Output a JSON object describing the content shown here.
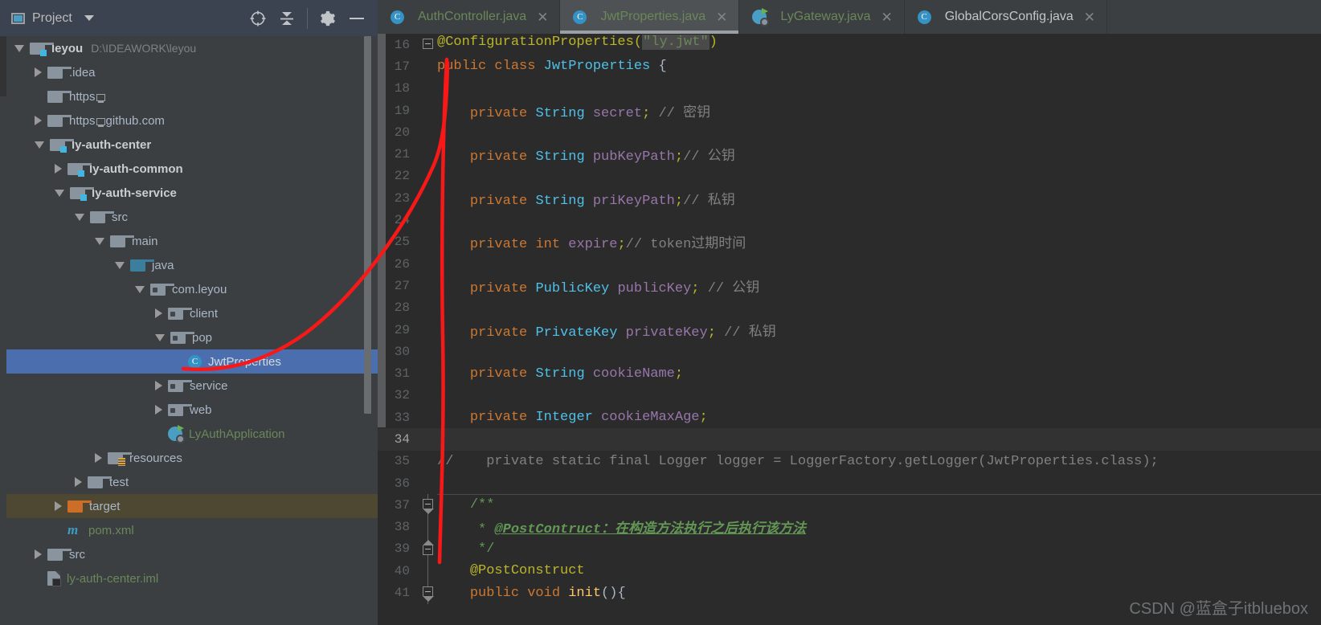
{
  "toolwindow": {
    "title": "Project",
    "title_icon": "project-view-icon",
    "dropdown_icon": "chevron-down-icon",
    "actions": [
      {
        "name": "locate-icon",
        "glyph": "scope-target"
      },
      {
        "name": "collapse-all-icon",
        "glyph": "collapse"
      },
      {
        "name": "settings-gear-icon",
        "glyph": "gear"
      },
      {
        "name": "minimize-icon",
        "glyph": "minus"
      }
    ]
  },
  "tree": [
    {
      "indent": 0,
      "arrow": "open",
      "icon": "module-folder-icon",
      "label": "leyou",
      "style": "bold",
      "hint": "D:\\IDEAWORK\\leyou"
    },
    {
      "indent": 1,
      "arrow": "closed",
      "icon": "folder-icon",
      "label": ".idea",
      "style": "plain",
      "hint": ""
    },
    {
      "indent": 1,
      "arrow": "none",
      "icon": "folder-icon",
      "label": "https",
      "style": "plain",
      "hint": "",
      "glyph_suffix": "monitor"
    },
    {
      "indent": 1,
      "arrow": "closed",
      "icon": "folder-icon",
      "label": "github.com",
      "style": "plain",
      "hint": "",
      "prefix": "https",
      "glyph_mid": "monitor"
    },
    {
      "indent": 1,
      "arrow": "open",
      "icon": "module-folder-icon",
      "label": "ly-auth-center",
      "style": "bold",
      "hint": ""
    },
    {
      "indent": 2,
      "arrow": "closed",
      "icon": "module-folder-icon",
      "label": "ly-auth-common",
      "style": "bold",
      "hint": ""
    },
    {
      "indent": 2,
      "arrow": "open",
      "icon": "module-folder-icon",
      "label": "ly-auth-service",
      "style": "bold",
      "hint": ""
    },
    {
      "indent": 3,
      "arrow": "open",
      "icon": "folder-icon",
      "label": "src",
      "style": "plain",
      "hint": ""
    },
    {
      "indent": 4,
      "arrow": "open",
      "icon": "folder-icon",
      "label": "main",
      "style": "plain",
      "hint": ""
    },
    {
      "indent": 5,
      "arrow": "open",
      "icon": "source-folder-icon",
      "label": "java",
      "style": "plain",
      "hint": ""
    },
    {
      "indent": 6,
      "arrow": "open",
      "icon": "package-icon",
      "label": "com.leyou",
      "style": "plain",
      "hint": ""
    },
    {
      "indent": 7,
      "arrow": "closed",
      "icon": "package-icon",
      "label": "client",
      "style": "plain",
      "hint": ""
    },
    {
      "indent": 7,
      "arrow": "open",
      "icon": "package-icon",
      "label": "pop",
      "style": "plain",
      "hint": ""
    },
    {
      "indent": 8,
      "arrow": "none",
      "icon": "java-class-icon",
      "label": "JwtProperties",
      "style": "white",
      "hint": "",
      "selected": true
    },
    {
      "indent": 7,
      "arrow": "closed",
      "icon": "package-icon",
      "label": "service",
      "style": "plain",
      "hint": ""
    },
    {
      "indent": 7,
      "arrow": "closed",
      "icon": "package-icon",
      "label": "web",
      "style": "plain",
      "hint": ""
    },
    {
      "indent": 7,
      "arrow": "none",
      "icon": "spring-boot-class-icon",
      "label": "LyAuthApplication",
      "style": "green",
      "hint": ""
    },
    {
      "indent": 4,
      "arrow": "closed",
      "icon": "resources-folder-icon",
      "label": "resources",
      "style": "plain",
      "hint": ""
    },
    {
      "indent": 3,
      "arrow": "closed",
      "icon": "folder-icon",
      "label": "test",
      "style": "plain",
      "hint": ""
    },
    {
      "indent": 2,
      "arrow": "closed",
      "icon": "target-folder-icon",
      "label": "target",
      "style": "plain",
      "hint": "",
      "highlighted": true
    },
    {
      "indent": 2,
      "arrow": "none",
      "icon": "maven-pom-icon",
      "label": "pom.xml",
      "style": "green",
      "hint": ""
    },
    {
      "indent": 1,
      "arrow": "closed",
      "icon": "folder-icon",
      "label": "src",
      "style": "plain",
      "hint": ""
    },
    {
      "indent": 1,
      "arrow": "none",
      "icon": "iml-file-icon",
      "label": "ly-auth-center.iml",
      "style": "green",
      "hint": ""
    }
  ],
  "tabs": [
    {
      "label": "AuthController.java",
      "icon": "java-class-icon",
      "active": false,
      "color": "green",
      "close_icon": "close-icon"
    },
    {
      "label": "JwtProperties.java",
      "icon": "java-class-icon",
      "active": true,
      "color": "green",
      "close_icon": "close-icon"
    },
    {
      "label": "LyGateway.java",
      "icon": "spring-boot-class-icon",
      "active": false,
      "color": "green",
      "close_icon": "close-icon"
    },
    {
      "label": "GlobalCorsConfig.java",
      "icon": "java-class-icon",
      "active": false,
      "color": "white",
      "close_icon": "close-icon"
    }
  ],
  "code": {
    "first_line": 16,
    "current_line": 34,
    "lines": [
      {
        "n": 16,
        "fold": "box",
        "clipped": true,
        "tokens": [
          {
            "t": "@ConfigurationProperties(",
            "c": "an"
          },
          {
            "t": "\"ly.jwt\"",
            "c": "s str-hl"
          },
          {
            "t": ")",
            "c": "an"
          }
        ]
      },
      {
        "n": 17,
        "fold": "",
        "tokens": [
          {
            "t": "public class ",
            "c": "k"
          },
          {
            "t": "JwtProperties",
            "c": "t"
          },
          {
            "t": " {",
            "c": "p"
          }
        ]
      },
      {
        "n": 18,
        "fold": "",
        "tokens": []
      },
      {
        "n": 19,
        "fold": "",
        "tokens": [
          {
            "t": "    ",
            "c": "p"
          },
          {
            "t": "private ",
            "c": "k"
          },
          {
            "t": "String",
            "c": "t"
          },
          {
            "t": " ",
            "c": "p"
          },
          {
            "t": "secret",
            "c": "f"
          },
          {
            "t": ";",
            "c": "an"
          },
          {
            "t": " // 密钥",
            "c": "c"
          }
        ]
      },
      {
        "n": 20,
        "fold": "",
        "tokens": []
      },
      {
        "n": 21,
        "fold": "",
        "tokens": [
          {
            "t": "    ",
            "c": "p"
          },
          {
            "t": "private ",
            "c": "k"
          },
          {
            "t": "String",
            "c": "t"
          },
          {
            "t": " ",
            "c": "p"
          },
          {
            "t": "pubKeyPath",
            "c": "f"
          },
          {
            "t": ";",
            "c": "an"
          },
          {
            "t": "// 公钥",
            "c": "c"
          }
        ]
      },
      {
        "n": 22,
        "fold": "",
        "tokens": []
      },
      {
        "n": 23,
        "fold": "",
        "tokens": [
          {
            "t": "    ",
            "c": "p"
          },
          {
            "t": "private ",
            "c": "k"
          },
          {
            "t": "String",
            "c": "t"
          },
          {
            "t": " ",
            "c": "p"
          },
          {
            "t": "priKeyPath",
            "c": "f"
          },
          {
            "t": ";",
            "c": "an"
          },
          {
            "t": "// 私钥",
            "c": "c"
          }
        ]
      },
      {
        "n": 24,
        "fold": "",
        "tokens": []
      },
      {
        "n": 25,
        "fold": "",
        "tokens": [
          {
            "t": "    ",
            "c": "p"
          },
          {
            "t": "private ",
            "c": "k"
          },
          {
            "t": "int",
            "c": "k"
          },
          {
            "t": " ",
            "c": "p"
          },
          {
            "t": "expire",
            "c": "f"
          },
          {
            "t": ";",
            "c": "an"
          },
          {
            "t": "// token过期时间",
            "c": "c"
          }
        ]
      },
      {
        "n": 26,
        "fold": "",
        "tokens": []
      },
      {
        "n": 27,
        "fold": "",
        "tokens": [
          {
            "t": "    ",
            "c": "p"
          },
          {
            "t": "private ",
            "c": "k"
          },
          {
            "t": "PublicKey",
            "c": "t"
          },
          {
            "t": " ",
            "c": "p"
          },
          {
            "t": "publicKey",
            "c": "f"
          },
          {
            "t": ";",
            "c": "an"
          },
          {
            "t": " // 公钥",
            "c": "c"
          }
        ]
      },
      {
        "n": 28,
        "fold": "",
        "tokens": []
      },
      {
        "n": 29,
        "fold": "",
        "tokens": [
          {
            "t": "    ",
            "c": "p"
          },
          {
            "t": "private ",
            "c": "k"
          },
          {
            "t": "PrivateKey",
            "c": "t"
          },
          {
            "t": " ",
            "c": "p"
          },
          {
            "t": "privateKey",
            "c": "f"
          },
          {
            "t": ";",
            "c": "an"
          },
          {
            "t": " // 私钥",
            "c": "c"
          }
        ]
      },
      {
        "n": 30,
        "fold": "",
        "tokens": []
      },
      {
        "n": 31,
        "fold": "",
        "tokens": [
          {
            "t": "    ",
            "c": "p"
          },
          {
            "t": "private ",
            "c": "k"
          },
          {
            "t": "String",
            "c": "t"
          },
          {
            "t": " ",
            "c": "p"
          },
          {
            "t": "cookieName",
            "c": "f"
          },
          {
            "t": ";",
            "c": "an"
          }
        ]
      },
      {
        "n": 32,
        "fold": "",
        "tokens": []
      },
      {
        "n": 33,
        "fold": "",
        "tokens": [
          {
            "t": "    ",
            "c": "p"
          },
          {
            "t": "private ",
            "c": "k"
          },
          {
            "t": "Integer",
            "c": "t"
          },
          {
            "t": " ",
            "c": "p"
          },
          {
            "t": "cookieMaxAge",
            "c": "f"
          },
          {
            "t": ";",
            "c": "an"
          }
        ]
      },
      {
        "n": 34,
        "fold": "",
        "current": true,
        "tokens": []
      },
      {
        "n": 35,
        "fold": "",
        "tokens": [
          {
            "t": "//    private static final Logger logger = LoggerFactory.getLogger(JwtProperties.class);",
            "c": "c"
          }
        ]
      },
      {
        "n": 36,
        "fold": "",
        "tokens": []
      },
      {
        "n": 37,
        "fold": "point-down",
        "separator": true,
        "tokens": [
          {
            "t": "    ",
            "c": "p"
          },
          {
            "t": "/**",
            "c": "docplain"
          }
        ]
      },
      {
        "n": 38,
        "fold": "",
        "tokens": [
          {
            "t": "     ",
            "c": "p"
          },
          {
            "t": "* ",
            "c": "docplain"
          },
          {
            "t": "@PostContruct：在构造方法执行之后执行该方法",
            "c": "doc"
          }
        ]
      },
      {
        "n": 39,
        "fold": "point-up",
        "tokens": [
          {
            "t": "     ",
            "c": "p"
          },
          {
            "t": "*/",
            "c": "docplain"
          }
        ]
      },
      {
        "n": 40,
        "fold": "",
        "tokens": [
          {
            "t": "    ",
            "c": "p"
          },
          {
            "t": "@PostConstruct",
            "c": "an"
          }
        ]
      },
      {
        "n": 41,
        "fold": "point-down",
        "tokens": [
          {
            "t": "    ",
            "c": "p"
          },
          {
            "t": "public void ",
            "c": "k"
          },
          {
            "t": "init",
            "c": "m"
          },
          {
            "t": "(){",
            "c": "p"
          }
        ]
      }
    ]
  },
  "annotation": {
    "name": "red-pen-annotation",
    "color": "#f81818"
  },
  "watermark": {
    "text": "CSDN @蓝盒子itbluebox"
  },
  "colors": {
    "sidebar_bg": "#3c3f41",
    "editor_bg": "#2b2b2b",
    "tab_active_bg": "#4e5254",
    "selection_blue": "#4b6eaf",
    "target_highlight": "#4e4832",
    "accent_cyan": "#3592c4",
    "annotation_red": "#f81818"
  }
}
